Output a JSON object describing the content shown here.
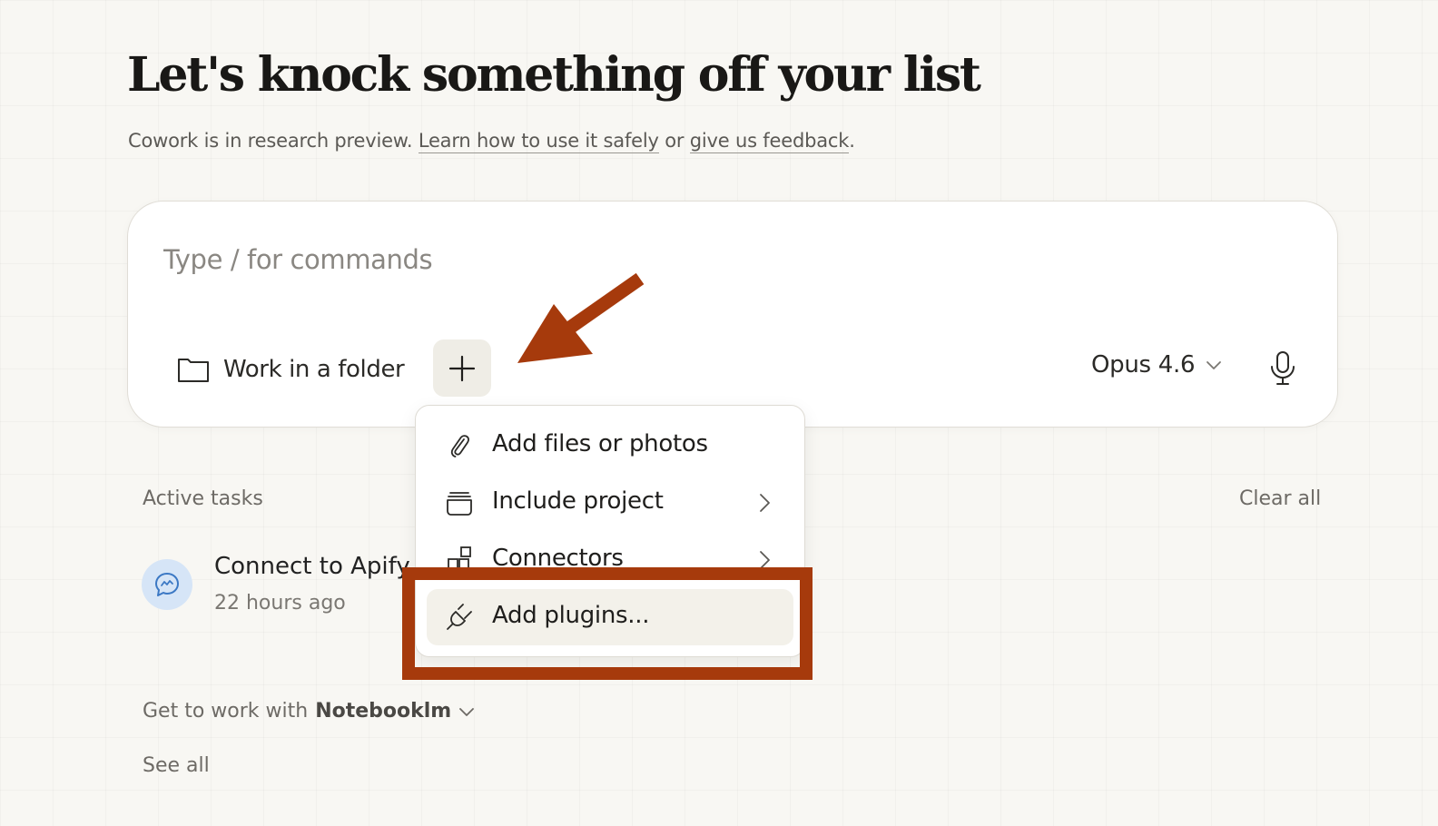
{
  "header": {
    "title": "Let's knock something off your list",
    "subtitle_prefix": "Cowork is in research preview.",
    "learn_link": "Learn how to use it safely",
    "or_text": "or",
    "feedback_link": "give us feedback",
    "period": "."
  },
  "composer": {
    "placeholder": "Type / for commands",
    "folder_label": "Work in a folder",
    "model_label": "Opus 4.6"
  },
  "menu": {
    "items": [
      {
        "label": "Add files or photos",
        "icon": "paperclip-icon",
        "submenu": false
      },
      {
        "label": "Include project",
        "icon": "project-box-icon",
        "submenu": true
      },
      {
        "label": "Connectors",
        "icon": "connectors-icon",
        "submenu": true
      },
      {
        "label": "Add plugins...",
        "icon": "plug-icon",
        "submenu": false,
        "highlighted": true
      }
    ]
  },
  "tasks": {
    "section_label": "Active tasks",
    "clear_label": "Clear all",
    "items": [
      {
        "title": "Connect to Apify",
        "time": "22 hours ago",
        "icon": "chat-bubble-icon"
      }
    ]
  },
  "footer": {
    "get_to_work_prefix": "Get to work with",
    "get_to_work_name": "Notebooklm",
    "see_all": "See all"
  },
  "annotation": {
    "color": "#a63a0c"
  }
}
